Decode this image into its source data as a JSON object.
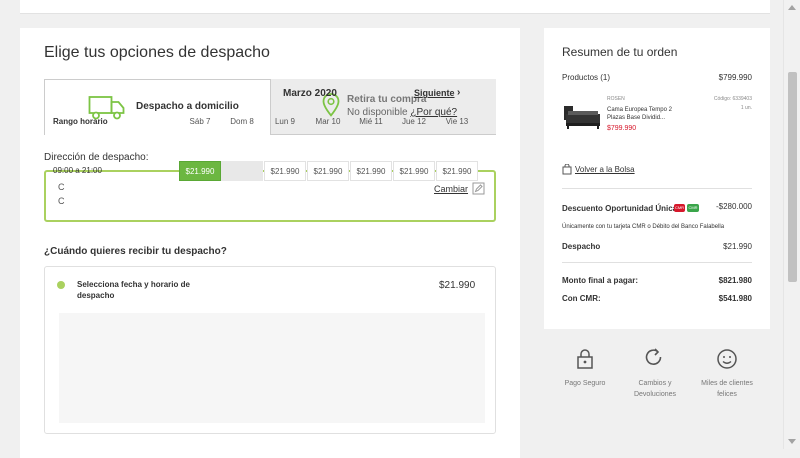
{
  "shipping": {
    "title": "Elige tus opciones de despacho",
    "tab_delivery_label": "Despacho a domicilio",
    "tab_pickup_title": "Retira tu compra",
    "tab_pickup_unavailable": "No disponible",
    "tab_pickup_why": "¿Por qué?",
    "address_label": "Dirección de despacho:",
    "address_line1": "C",
    "address_line2": "C",
    "change_label": "Cambiar",
    "when_label": "¿Cuándo quieres recibir tu despacho?",
    "select_label": "Selecciona fecha y horario de despacho",
    "select_price": "$21.990",
    "month": "Marzo 2020",
    "next_label": "Siguiente",
    "next_arrow": "›",
    "range_header": "Rango horario",
    "days": [
      "Sáb 7",
      "Dom 8",
      "Lun 9",
      "Mar 10",
      "Mié 11",
      "Jue 12",
      "Vie 13"
    ],
    "hours": "09:00 a 21:00",
    "slots": [
      "$21.990",
      "",
      "$21.990",
      "$21.990",
      "$21.990",
      "$21.990",
      "$21.990"
    ],
    "selected_slot_index": 0
  },
  "summary": {
    "title": "Resumen de tu orden",
    "products_label": "Productos (1)",
    "products_total": "$799.990",
    "product": {
      "brand": "ROSEN",
      "name": "Cama Europea Tempo 2 Plazas Base Dividid...",
      "price": "$799.990",
      "code": "Código: 6339403",
      "qty": "1 un."
    },
    "back_to_bag": "Volver a la Bolsa",
    "discount_label": "Descuento Oportunidad Única",
    "discount_badge_1": "CMR",
    "discount_badge_2": "CMR",
    "discount_value": "-$280.000",
    "discount_note": "Únicamente con tu tarjeta CMR o Débito del Banco Falabella",
    "shipping_label": "Despacho",
    "shipping_value": "$21.990",
    "final_label": "Monto final a pagar:",
    "final_value": "$821.980",
    "cmr_label": "Con CMR:",
    "cmr_value": "$541.980"
  },
  "trust": {
    "secure": "Pago Seguro",
    "returns": "Cambios y Devoluciones",
    "clients": "Miles de clientes felices"
  },
  "colors": {
    "accent_green": "#aad15f",
    "slot_green": "#6cb741",
    "price_red": "#d6182b"
  }
}
